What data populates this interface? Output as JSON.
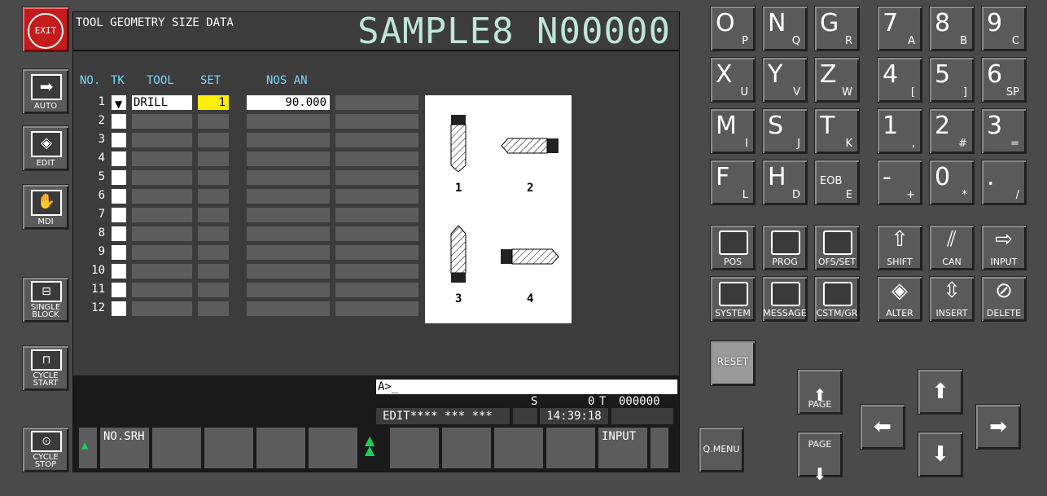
{
  "left_buttons": {
    "exit": "EXIT",
    "auto": "AUTO",
    "edit": "EDIT",
    "mdi": "MDI",
    "single_block": [
      "SINGLE",
      "BLOCK"
    ],
    "cycle_start": [
      "CYCLE",
      "START"
    ],
    "cycle_stop": [
      "CYCLE",
      "STOP"
    ]
  },
  "screen": {
    "title": "TOOL GEOMETRY SIZE DATA",
    "program": "SAMPLE8 N00000",
    "headers": {
      "no": "NO.",
      "tk": "TK",
      "tool": "TOOL",
      "set": "SET",
      "nos_an": "NOS AN"
    },
    "rows": [
      {
        "no": "1",
        "tool": "DRILL",
        "set": "1",
        "nos_an": "90.000"
      },
      {
        "no": "2"
      },
      {
        "no": "3"
      },
      {
        "no": "4"
      },
      {
        "no": "5"
      },
      {
        "no": "6"
      },
      {
        "no": "7"
      },
      {
        "no": "8"
      },
      {
        "no": "9"
      },
      {
        "no": "10"
      },
      {
        "no": "11"
      },
      {
        "no": "12"
      }
    ],
    "diagram_labels": [
      "1",
      "2",
      "3",
      "4"
    ],
    "input_prompt": "A>_",
    "status": {
      "s": "S",
      "s_val": "0",
      "t": "T",
      "t_val": "000000",
      "mode": "EDIT**** *** ***",
      "time": "14:39:18"
    },
    "softkeys": {
      "left": "NO.SRH",
      "right": "INPUT"
    }
  },
  "keypad": {
    "letters": [
      {
        "main": "O",
        "sub": "P"
      },
      {
        "main": "N",
        "sub": "Q"
      },
      {
        "main": "G",
        "sub": "R"
      },
      {
        "main": "X",
        "sub": "U"
      },
      {
        "main": "Y",
        "sub": "V"
      },
      {
        "main": "Z",
        "sub": "W"
      },
      {
        "main": "M",
        "sub": "I"
      },
      {
        "main": "S",
        "sub": "J"
      },
      {
        "main": "T",
        "sub": "K"
      },
      {
        "main": "F",
        "sub": "L"
      },
      {
        "main": "H",
        "sub": "D"
      },
      {
        "main": "EOB",
        "sub": "E"
      }
    ],
    "numbers": [
      {
        "main": "7",
        "sub": "A"
      },
      {
        "main": "8",
        "sub": "B"
      },
      {
        "main": "9",
        "sub": "C"
      },
      {
        "main": "4",
        "sub": "["
      },
      {
        "main": "5",
        "sub": "]"
      },
      {
        "main": "6",
        "sub": "SP"
      },
      {
        "main": "1",
        "sub": ","
      },
      {
        "main": "2",
        "sub": "#"
      },
      {
        "main": "3",
        "sub": "="
      },
      {
        "main": "-",
        "sub": "+"
      },
      {
        "main": "0",
        "sub": "*"
      },
      {
        "main": ".",
        "sub": "/"
      }
    ],
    "functions": [
      "POS",
      "PROG",
      "OFS/SET",
      "SYSTEM",
      "MESSAGE",
      "CSTM/GR"
    ],
    "edits": [
      "SHIFT",
      "CAN",
      "INPUT",
      "ALTER",
      "INSERT",
      "DELETE"
    ],
    "reset": "RESET",
    "qmenu": "Q.MENU",
    "page": "PAGE"
  }
}
